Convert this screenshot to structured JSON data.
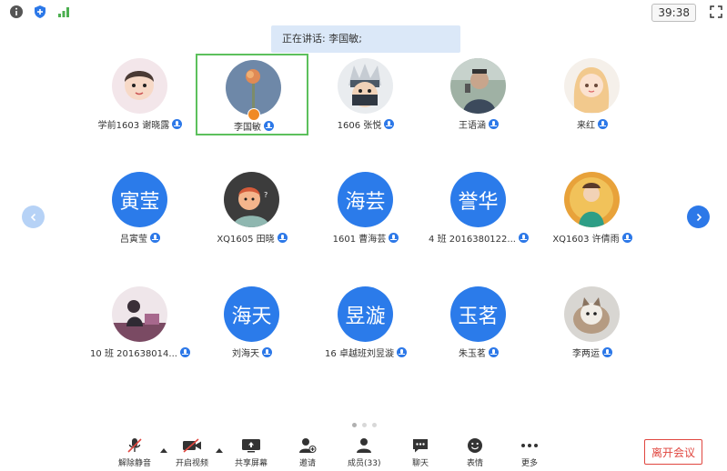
{
  "topbar": {
    "info_icon": "info-icon",
    "shield_icon": "shield-icon",
    "signal_icon": "signal-icon",
    "timer": "39:38",
    "fullscreen_icon": "fullscreen-icon"
  },
  "speaking": {
    "label": "正在讲话: 李国敏;"
  },
  "participants": [
    {
      "name": "学前1603 谢晓露",
      "avatar_text": "",
      "avatar_kind": "photo-baby",
      "active": false
    },
    {
      "name": "李国敏",
      "avatar_text": "",
      "avatar_kind": "photo-flower",
      "active": true
    },
    {
      "name": "1606 张悦",
      "avatar_text": "",
      "avatar_kind": "photo-ninja",
      "active": false
    },
    {
      "name": "王语涵",
      "avatar_text": "",
      "avatar_kind": "photo-man",
      "active": false
    },
    {
      "name": "来红",
      "avatar_text": "",
      "avatar_kind": "photo-girl",
      "active": false
    },
    {
      "name": "吕寅莹",
      "avatar_text": "寅莹",
      "avatar_kind": "text",
      "active": false
    },
    {
      "name": "XQ1605 田晓",
      "avatar_text": "",
      "avatar_kind": "photo-cartoon",
      "active": false
    },
    {
      "name": "1601 曹海芸",
      "avatar_text": "海芸",
      "avatar_kind": "text",
      "active": false
    },
    {
      "name": "4 班 2016380122...",
      "avatar_text": "誉华",
      "avatar_kind": "text",
      "active": false
    },
    {
      "name": "XQ1603 许倩雨",
      "avatar_text": "",
      "avatar_kind": "photo-boy",
      "active": false
    },
    {
      "name": "10 班 201638014...",
      "avatar_text": "",
      "avatar_kind": "photo-desk",
      "active": false
    },
    {
      "name": "刘海天",
      "avatar_text": "海天",
      "avatar_kind": "text",
      "active": false
    },
    {
      "name": "16 卓越班刘昱漩",
      "avatar_text": "昱漩",
      "avatar_kind": "text",
      "active": false
    },
    {
      "name": "朱玉茗",
      "avatar_text": "玉茗",
      "avatar_kind": "text",
      "active": false
    },
    {
      "name": "李两运",
      "avatar_text": "",
      "avatar_kind": "photo-cat",
      "active": false
    }
  ],
  "pagination": {
    "pages": 3,
    "current": 1
  },
  "toolbar": {
    "unmute": "解除静音",
    "start_video": "开启视频",
    "share_screen": "共享屏幕",
    "invite": "邀请",
    "members": "成员(33)",
    "chat": "聊天",
    "emoji": "表情",
    "more": "更多",
    "leave": "离开会议"
  },
  "colors": {
    "accent": "#2c78e8",
    "active_border": "#5cc05c",
    "leave": "#e0463f"
  }
}
